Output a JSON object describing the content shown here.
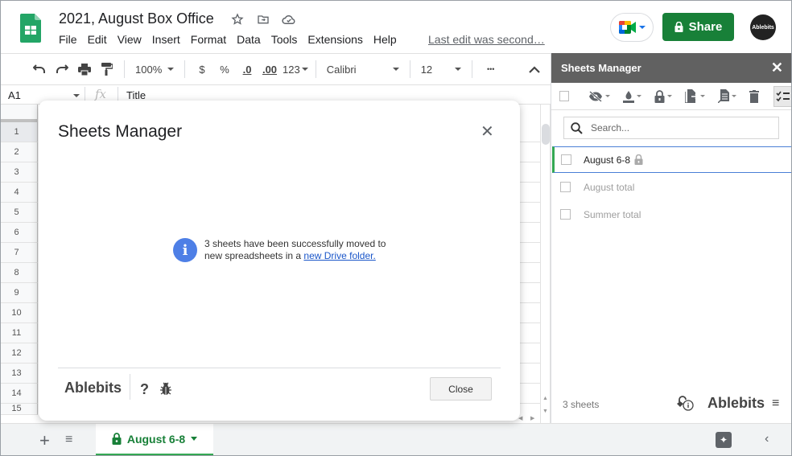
{
  "header": {
    "doc_title": "2021, August Box Office",
    "menu": [
      "File",
      "Edit",
      "View",
      "Insert",
      "Format",
      "Data",
      "Tools",
      "Extensions",
      "Help"
    ],
    "last_edit": "Last edit was second…",
    "share_label": "Share",
    "avatar_label": "Ablebits"
  },
  "toolbar": {
    "zoom": "100%",
    "currency": "$",
    "percent": "%",
    "decrease_decimal": ".0",
    "increase_decimal": ".00",
    "number_format": "123",
    "font": "Calibri",
    "font_size": "12",
    "more": "•••"
  },
  "formula_bar": {
    "cell_ref": "A1",
    "fx": "fx",
    "value": "Title"
  },
  "grid": {
    "rows": [
      "1",
      "2",
      "3",
      "4",
      "5",
      "6",
      "7",
      "8",
      "9",
      "10",
      "11",
      "12",
      "13",
      "14",
      "15"
    ]
  },
  "sheet_tabs": {
    "active": "August 6-8",
    "add": "+",
    "all_sheets": "≡"
  },
  "side_panel": {
    "title": "Sheets Manager",
    "search_placeholder": "Search...",
    "sheets": [
      {
        "name": "August 6-8",
        "locked": true,
        "active": true
      },
      {
        "name": "August total",
        "locked": false,
        "active": false
      },
      {
        "name": "Summer total",
        "locked": false,
        "active": false
      }
    ],
    "count": "3 sheets",
    "brand": "Ablebits"
  },
  "dialog": {
    "title": "Sheets Manager",
    "message_line1": "3 sheets have been successfully moved to",
    "message_line2_prefix": "new spreadsheets in a ",
    "message_link": "new Drive folder.",
    "brand": "Ablebits",
    "help": "?",
    "close_label": "Close"
  },
  "colors": {
    "share_green": "#188038",
    "tab_green": "#34a853",
    "info_blue": "#4e7fe6",
    "panel_header": "#616161"
  }
}
